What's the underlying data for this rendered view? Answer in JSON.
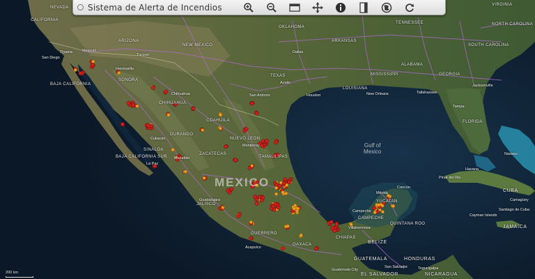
{
  "app": {
    "title": "Sistema de Alerta de Incendios"
  },
  "toolbar": {
    "tools": [
      {
        "name": "zoom-in-icon"
      },
      {
        "name": "zoom-out-icon"
      },
      {
        "name": "full-extent-icon"
      },
      {
        "name": "pan-icon"
      },
      {
        "name": "info-icon"
      },
      {
        "name": "layers-icon"
      },
      {
        "name": "basemap-icon"
      },
      {
        "name": "refresh-icon"
      }
    ]
  },
  "map": {
    "country_label": "MEXICO",
    "gulf_label": "Gulf of\nMexico",
    "countries": [
      "CUBA",
      "JAMAICA",
      "BELIZE",
      "GUATEMALA",
      "HONDURAS",
      "EL SALVADOR",
      "NICARAGUA"
    ],
    "states": [
      "SONORA",
      "CHIHUAHUA",
      "COAHUILA",
      "NUEVO LEON",
      "DURANGO",
      "SINALOA",
      "ZACATECAS",
      "BAJA CALIFORNIA",
      "BAJA CALIFORNIA SUR",
      "TAMAULIPAS",
      "JALISCO",
      "GUERRERO",
      "OAXACA",
      "CHIAPAS",
      "CAMPECHE",
      "YUCATAN",
      "QUINTANA ROO",
      "TEXAS",
      "OKLAHOMA",
      "ARKANSAS",
      "LOUISIANA",
      "MISSISSIPPI",
      "ALABAMA",
      "GEORGIA",
      "FLORIDA",
      "TENNESSEE",
      "NORTH CAROLINA",
      "SOUTH CAROLINA",
      "VIRGINIA",
      "NEW MEXICO",
      "ARIZONA",
      "CALIFORNIA",
      "NEVADA"
    ],
    "cities": [
      "San Diego",
      "Tucson",
      "Dallas",
      "Austin",
      "Houston",
      "San Antonio",
      "New Orleans",
      "Jacksonville",
      "Tampa",
      "Havana",
      "Monterrey",
      "Guadalajara",
      "Acapulco",
      "La Paz",
      "Tallahassee",
      "Nassau",
      "Cancún",
      "Mérida",
      "Campeche",
      "Villahermosa",
      "Tegucigalpa",
      "San Salvador",
      "Guatemala City",
      "Chihuahua",
      "Hermosillo",
      "Culiacán",
      "Mazatlán",
      "Tijuana",
      "Mexicali",
      "Pinar del Rio",
      "Camagüey",
      "Santiago de Cuba",
      "Cayman Islands"
    ],
    "scale_text": "200 km",
    "colors": {
      "ocean": "#0c1a2a",
      "land": "#4f5a34",
      "roads": "#b06ad0",
      "alert_high": "#d0201a",
      "alert_low": "#f0a020"
    }
  }
}
